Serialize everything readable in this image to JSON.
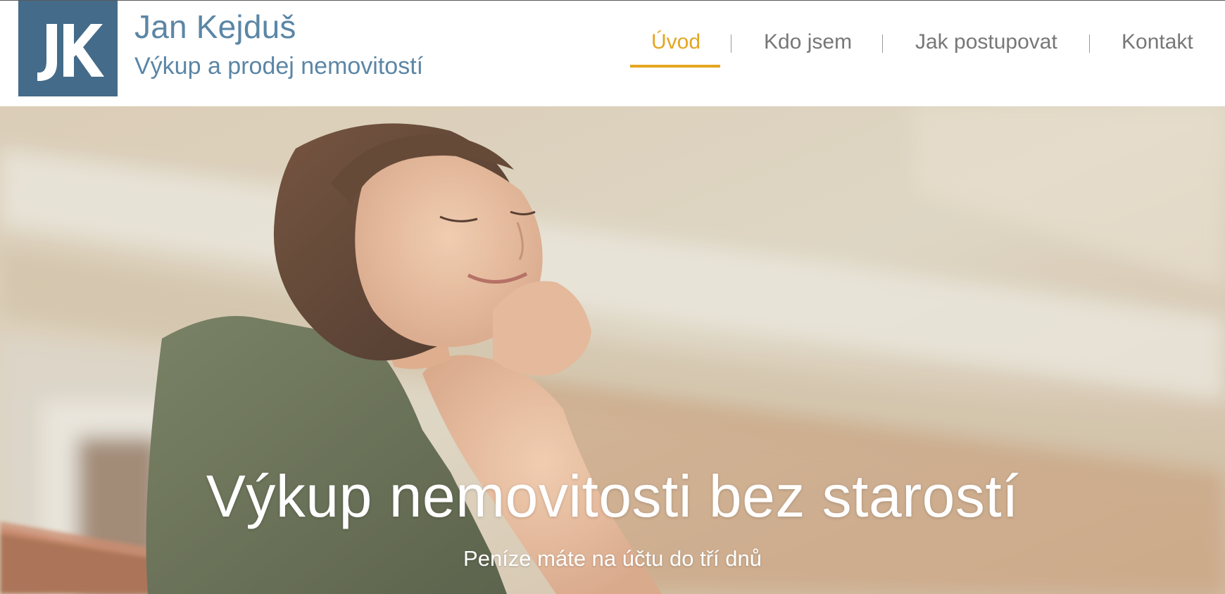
{
  "brand": {
    "logo_letters": "JK",
    "name": "Jan Kejduš",
    "tagline": "Výkup a prodej nemovitostí",
    "color": "#5b86a6",
    "logo_bg": "#446b89"
  },
  "nav": {
    "items": [
      {
        "label": "Úvod",
        "active": true
      },
      {
        "label": "Kdo jsem",
        "active": false
      },
      {
        "label": "Jak postupovat",
        "active": false
      },
      {
        "label": "Kontakt",
        "active": false
      }
    ],
    "active_color": "#e6a521",
    "color": "#777777"
  },
  "hero": {
    "title": "Výkup nemovitosti bez starostí",
    "subtitle": "Peníze máte na účtu do tří dnů",
    "image": "woman-sunbathing-on-balcony"
  }
}
